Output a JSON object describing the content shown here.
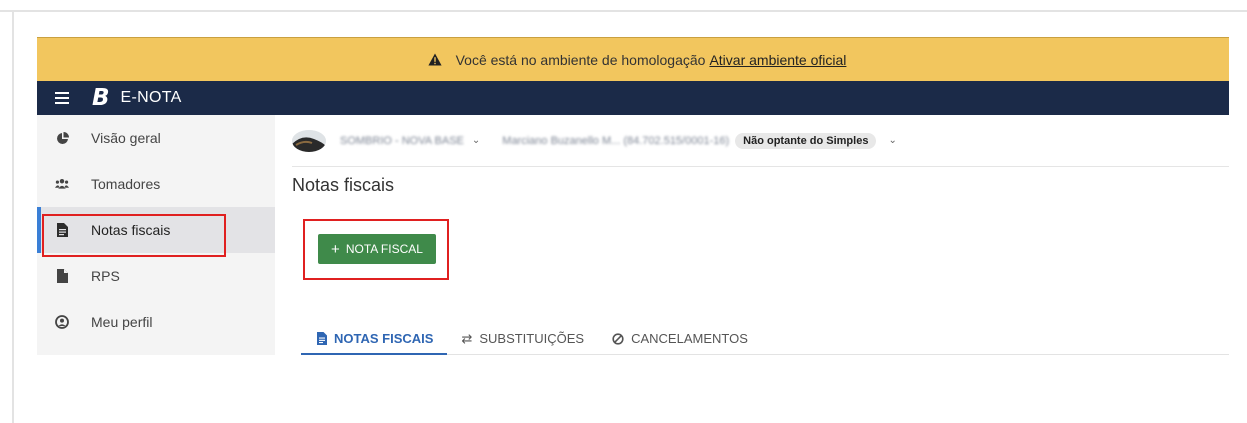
{
  "banner": {
    "message": "Você está no ambiente de homologação",
    "link": "Ativar ambiente oficial"
  },
  "navbar": {
    "logo_letter": "B",
    "brand": "E-NOTA"
  },
  "sidebar": {
    "items": [
      {
        "label": "Visão geral",
        "icon": "pie-chart-icon"
      },
      {
        "label": "Tomadores",
        "icon": "users-icon"
      },
      {
        "label": "Notas fiscais",
        "icon": "file-text-icon",
        "active": true
      },
      {
        "label": "RPS",
        "icon": "file-icon"
      },
      {
        "label": "Meu perfil",
        "icon": "user-circle-icon"
      }
    ]
  },
  "context": {
    "company": "SOMBRIO - NOVA BASE",
    "taxpayer": "Marciano Buzanello M... (84.702.515/0001-16)",
    "tax_regime": "Não optante do Simples"
  },
  "main": {
    "title": "Notas fiscais",
    "new_button_plus": "+",
    "new_button_label": "NOTA FISCAL",
    "tabs": [
      {
        "label": "NOTAS FISCAIS",
        "icon": "file-text-icon",
        "active": true
      },
      {
        "label": "SUBSTITUIÇÕES",
        "icon": "swap-icon"
      },
      {
        "label": "CANCELAMENTOS",
        "icon": "ban-icon"
      }
    ]
  },
  "colors": {
    "banner": "#f2c65e",
    "navbar": "#1b2a48",
    "primary_button": "#3f8a4a",
    "active_tab": "#2f66b3",
    "highlight_box": "#e02020"
  }
}
